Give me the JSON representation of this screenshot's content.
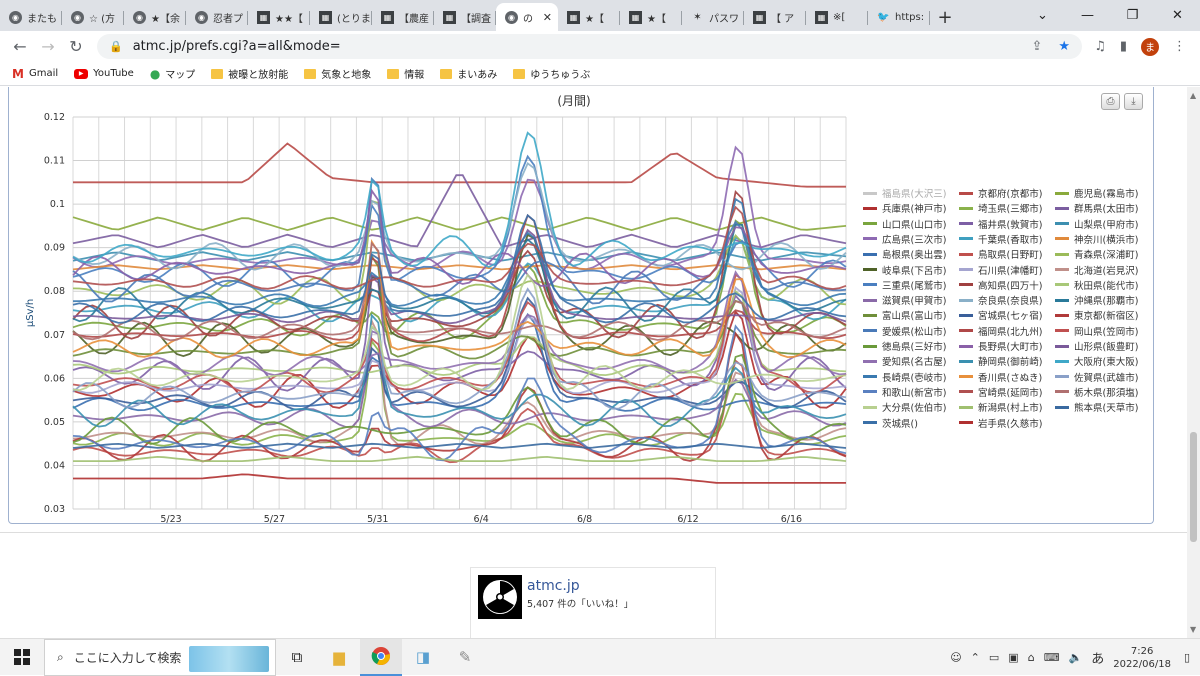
{
  "tabs": [
    {
      "label": "またも",
      "icon": "globe-icon"
    },
    {
      "label": "☆ (方",
      "icon": "globe-icon"
    },
    {
      "label": "★【余",
      "icon": "globe-icon"
    },
    {
      "label": "忍者プ",
      "icon": "globe-icon"
    },
    {
      "label": "★★【",
      "icon": "site-icon"
    },
    {
      "label": "(とりま",
      "icon": "site-icon"
    },
    {
      "label": "【農産",
      "icon": "site-icon"
    },
    {
      "label": "【調査",
      "icon": "site-icon"
    },
    {
      "label": "の",
      "icon": "globe-icon",
      "active": true
    },
    {
      "label": "★【",
      "icon": "site-icon"
    },
    {
      "label": "★【",
      "icon": "site-icon"
    },
    {
      "label": "パスワ",
      "icon": "puzzle-icon"
    },
    {
      "label": "【 ア",
      "icon": "site-icon"
    },
    {
      "label": "※[",
      "icon": "site-icon"
    },
    {
      "label": "https:",
      "icon": "twitter-icon"
    }
  ],
  "address": {
    "url": "atmc.jp/prefs.cgi?a=all&mode="
  },
  "profile": {
    "initial": "ま"
  },
  "bookmarks": [
    "Gmail",
    "YouTube",
    "マップ",
    "被曝と放射能",
    "気象と地象",
    "情報",
    "まいあみ",
    "ゆうちゅうぶ"
  ],
  "chart_data": {
    "type": "line",
    "title": "(月間)",
    "ylabel": "µSv/h",
    "ylim": [
      0.03,
      0.12
    ],
    "yticks": [
      "0.03",
      "0.04",
      "0.05",
      "0.06",
      "0.07",
      "0.08",
      "0.09",
      "0.1",
      "0.11",
      "0.12"
    ],
    "xticks": [
      "5/23",
      "5/27",
      "5/31",
      "6/4",
      "6/8",
      "6/12",
      "6/16"
    ],
    "series": [
      {
        "name": "福島県(大沢三)",
        "color": "#c8c8c8",
        "values": []
      },
      {
        "name": "京都府(京都市)",
        "color": "#b84a47",
        "values": [
          0.105,
          0.105,
          0.105,
          0.105,
          0.105,
          0.114,
          0.106,
          0.105,
          0.105,
          0.105,
          0.105,
          0.105,
          0.105,
          0.105,
          0.112,
          0.106,
          0.105,
          0.104,
          0.104
        ]
      },
      {
        "name": "鹿児島(霧島市)",
        "color": "#8aaa3c",
        "values": [
          0.097,
          0.094,
          0.097,
          0.094,
          0.097,
          0.094,
          0.097,
          0.094,
          0.097,
          0.094,
          0.097,
          0.094,
          0.097,
          0.094,
          0.097,
          0.094,
          0.097,
          0.094,
          0.095
        ]
      },
      {
        "name": "兵庫県(神戸市)",
        "color": "#b03030",
        "values": []
      },
      {
        "name": "埼玉県(三郷市)",
        "color": "#8ab24b",
        "values": []
      },
      {
        "name": "群馬県(太田市)",
        "color": "#7b5ea0",
        "values": [
          0.091,
          0.093,
          0.09,
          0.093,
          0.09,
          0.093,
          0.09,
          0.093,
          0.09,
          0.108,
          0.09,
          0.093,
          0.09,
          0.093,
          0.09,
          0.093,
          0.09,
          0.093,
          0.091
        ]
      },
      {
        "name": "山口県(山口市)",
        "color": "#7aa53e",
        "values": []
      },
      {
        "name": "福井県(敦賀市)",
        "color": "#7d5fa5",
        "values": []
      },
      {
        "name": "山梨県(甲府市)",
        "color": "#3d8fb0",
        "values": [
          0.087,
          0.089,
          0.087,
          0.089,
          0.087,
          0.089,
          0.087,
          0.089,
          0.087,
          0.089,
          0.087,
          0.089,
          0.087,
          0.089,
          0.087,
          0.089,
          0.087,
          0.089,
          0.088
        ]
      },
      {
        "name": "広島県(三次市)",
        "color": "#8e6ab3",
        "values": []
      },
      {
        "name": "千葉県(香取市)",
        "color": "#3fa0c0",
        "values": []
      },
      {
        "name": "神奈川(横浜市)",
        "color": "#e08a3c",
        "values": [
          0.085,
          0.086,
          0.085,
          0.086,
          0.085,
          0.086,
          0.085,
          0.086,
          0.085,
          0.086,
          0.085,
          0.086,
          0.085,
          0.086,
          0.085,
          0.086,
          0.085,
          0.086,
          0.085
        ]
      },
      {
        "name": "島根県(奥出雲)",
        "color": "#3a6fb0",
        "values": []
      },
      {
        "name": "鳥取県(日野町)",
        "color": "#c0504d",
        "values": []
      },
      {
        "name": "青森県(深浦町)",
        "color": "#9bbb59",
        "values": []
      },
      {
        "name": "岐阜県(下呂市)",
        "color": "#4f6228",
        "values": []
      },
      {
        "name": "石川県(津幡町)",
        "color": "#a5a5d0",
        "values": []
      },
      {
        "name": "北海道(岩見沢)",
        "color": "#c0908a",
        "values": []
      },
      {
        "name": "三重県(尾鷲市)",
        "color": "#4a7fc0",
        "values": []
      },
      {
        "name": "高知県(四万十)",
        "color": "#a04040",
        "values": []
      },
      {
        "name": "秋田県(能代市)",
        "color": "#a8c878",
        "values": []
      },
      {
        "name": "滋賀県(甲賀市)",
        "color": "#8a6aa8",
        "values": []
      },
      {
        "name": "奈良県(奈良県)",
        "color": "#8ab0c8",
        "values": []
      },
      {
        "name": "沖縄県(那覇市)",
        "color": "#2a7a9a",
        "values": []
      },
      {
        "name": "富山県(富山市)",
        "color": "#6f8f3a",
        "values": []
      },
      {
        "name": "宮城県(七ヶ宿)",
        "color": "#3a5f9a",
        "values": []
      },
      {
        "name": "東京都(新宿区)",
        "color": "#b03a3a",
        "values": []
      },
      {
        "name": "愛媛県(松山市)",
        "color": "#4a7ab8",
        "values": []
      },
      {
        "name": "福岡県(北九州)",
        "color": "#b04848",
        "values": []
      },
      {
        "name": "岡山県(笠岡市)",
        "color": "#c05050",
        "values": []
      },
      {
        "name": "徳島県(三好市)",
        "color": "#6a9a3a",
        "values": []
      },
      {
        "name": "長野県(大町市)",
        "color": "#8a60a8",
        "values": []
      },
      {
        "name": "山形県(飯豊町)",
        "color": "#7a5a9a",
        "values": []
      },
      {
        "name": "愛知県(名古屋)",
        "color": "#9070b0",
        "values": []
      },
      {
        "name": "静岡県(御前崎)",
        "color": "#3a90b0",
        "values": []
      },
      {
        "name": "大阪府(東大阪)",
        "color": "#3fa8c8",
        "values": []
      },
      {
        "name": "長崎県(壱岐市)",
        "color": "#3a7ab0",
        "values": []
      },
      {
        "name": "香川県(さぬき)",
        "color": "#e8903c",
        "values": []
      },
      {
        "name": "佐賀県(武雄市)",
        "color": "#8aa0c8",
        "values": []
      },
      {
        "name": "和歌山(新宮市)",
        "color": "#5a80c0",
        "values": []
      },
      {
        "name": "宮崎県(延岡市)",
        "color": "#b05050",
        "values": []
      },
      {
        "name": "栃木県(那須塩)",
        "color": "#b07070",
        "values": []
      },
      {
        "name": "大分県(佐伯市)",
        "color": "#b8d090",
        "values": []
      },
      {
        "name": "新潟県(村上市)",
        "color": "#a0c070",
        "values": [
          0.041,
          0.041,
          0.042,
          0.041,
          0.041,
          0.042,
          0.041,
          0.041,
          0.042,
          0.041,
          0.041,
          0.042,
          0.041,
          0.041,
          0.042,
          0.041,
          0.041,
          0.042,
          0.041
        ]
      },
      {
        "name": "熊本県(天草市)",
        "color": "#3a6aa0",
        "values": [
          0.044,
          0.045,
          0.044,
          0.045,
          0.044,
          0.045,
          0.044,
          0.045,
          0.044,
          0.045,
          0.044,
          0.045,
          0.044,
          0.045,
          0.044,
          0.045,
          0.044,
          0.045,
          0.044
        ]
      },
      {
        "name": "茨城県()",
        "color": "#3a70a8",
        "values": []
      },
      {
        "name": "岩手県(久慈市)",
        "color": "#b03030",
        "values": [
          0.037,
          0.037,
          0.037,
          0.037,
          0.038,
          0.037,
          0.037,
          0.037,
          0.037,
          0.037,
          0.037,
          0.037,
          0.037,
          0.037,
          0.037,
          0.036,
          0.036,
          0.036,
          0.036
        ]
      }
    ]
  },
  "social": {
    "name": "atmc.jp",
    "likes": "5,407 件の「いいね！」"
  },
  "taskbar": {
    "search_placeholder": "ここに入力して検索",
    "time": "7:26",
    "date": "2022/06/18",
    "ime": "あ"
  }
}
